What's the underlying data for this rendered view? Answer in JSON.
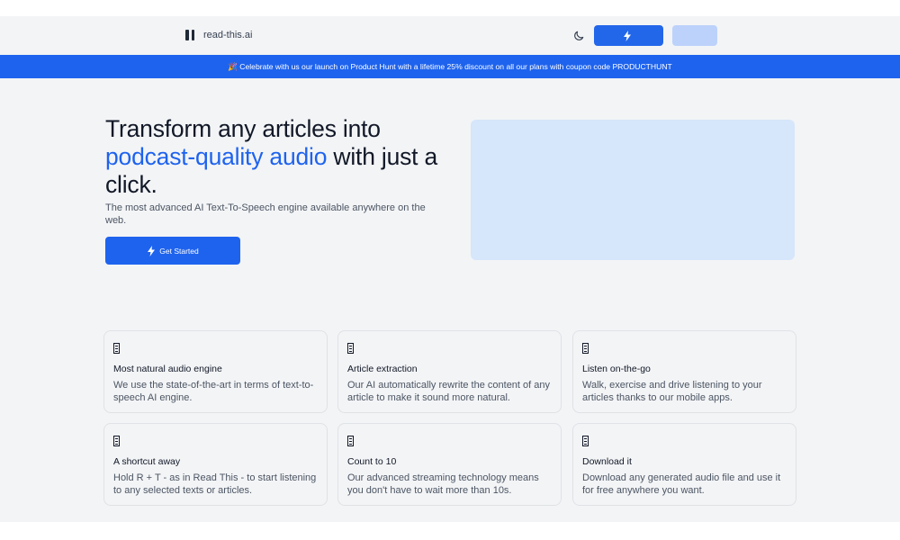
{
  "header": {
    "logo_text": "read-this.ai",
    "primary_button_label": "",
    "secondary_button_label": ""
  },
  "banner": {
    "text": "🎉 Celebrate with us our launch on Product Hunt with a lifetime 25% discount on all our plans with coupon code PRODUCTHUNT"
  },
  "hero": {
    "title_part1": "Transform any articles into ",
    "title_accent": "podcast-quality audio",
    "title_part2": " with just a click.",
    "subtitle": "The most advanced AI Text-To-Speech engine available anywhere on the web.",
    "cta_label": "Get Started"
  },
  "features": [
    {
      "icon": "feature-icon",
      "title": "Most natural audio engine",
      "description": "We use the state-of-the-art in terms of text-to-speech AI engine."
    },
    {
      "icon": "feature-icon",
      "title": "Article extraction",
      "description": "Our AI automatically rewrite the content of any article to make it sound more natural."
    },
    {
      "icon": "feature-icon",
      "title": "Listen on-the-go",
      "description": "Walk, exercise and drive listening to your articles thanks to our mobile apps."
    },
    {
      "icon": "feature-icon",
      "title": "A shortcut away",
      "description": "Hold R + T - as in Read This - to start listening to any selected texts or articles."
    },
    {
      "icon": "feature-icon",
      "title": "Count to 10",
      "description": "Our advanced streaming technology means you don't have to wait more than 10s."
    },
    {
      "icon": "feature-icon",
      "title": "Download it",
      "description": "Download any generated audio file and use it for free anywhere you want."
    }
  ],
  "colors": {
    "accent": "#1e63ee",
    "background": "#f3f4f6",
    "media_placeholder": "#d6e6fb"
  }
}
